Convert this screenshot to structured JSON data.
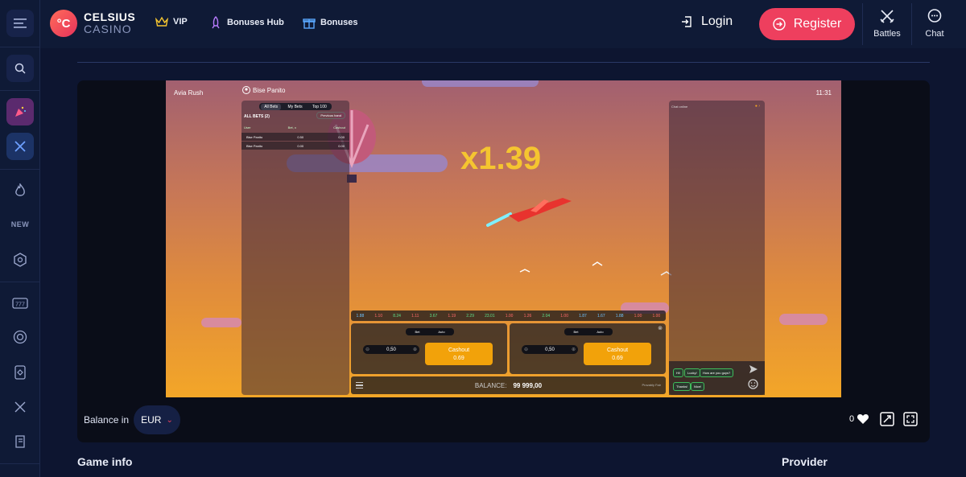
{
  "header": {
    "logo_top": "CELSIUS",
    "logo_bottom": "CASINO",
    "logo_mark": "°C",
    "nav": [
      {
        "label": "VIP",
        "icon": "crown-icon"
      },
      {
        "label": "Bonuses Hub",
        "icon": "rocket-icon"
      },
      {
        "label": "Bonuses",
        "icon": "gift-icon"
      }
    ],
    "login_label": "Login",
    "register_label": "Register",
    "battles_label": "Battles",
    "chat_label": "Chat"
  },
  "sidebar": {
    "new_label": "NEW"
  },
  "game": {
    "title": "Avia Rush",
    "user": "Bise Panito",
    "time": "11:31",
    "multiplier": "x1.39",
    "tabs": [
      "All Bets",
      "My Bets",
      "Top 100"
    ],
    "all_bets_label": "ALL BETS (2)",
    "previous_hand": "Previous hand",
    "table_headers": [
      "User",
      "Bet, x",
      "Cashout"
    ],
    "rows": [
      {
        "user": "Bise Panito",
        "bet": "0.50",
        "cashout": "0.00"
      },
      {
        "user": "Bise Panito",
        "bet": "0.00",
        "cashout": "0.00"
      }
    ],
    "history": [
      "1.88",
      "1.10",
      "8.24",
      "1.11",
      "3.67",
      "1.19",
      "2.29",
      "23.01",
      "1.00",
      "1.26",
      "2.04",
      "1.00",
      "1.87",
      "1.67",
      "1.88",
      "1.00",
      "1.00"
    ],
    "bet_tabs": [
      "Bet",
      "Auto"
    ],
    "bet_amount": "0,50",
    "cashout_label": "Cashout",
    "cashout_value": "0.69",
    "balance_label": "BALANCE:",
    "balance_value": "99 999,00",
    "provably_fair": "Provably Fair",
    "chat_title": "Chat online",
    "chat_msgs": [
      "Hi!",
      "Lucky!",
      "How are you guys?",
      "Thanks!",
      "Nice!"
    ]
  },
  "below": {
    "balance_in": "Balance in",
    "currency": "EUR",
    "likes": "0"
  },
  "sections": {
    "game_info": "Game info",
    "provider": "Provider"
  },
  "colors": {
    "accent": "#ee3f5e",
    "background": "#0d1530",
    "multiplier": "#f5c530",
    "cashout": "#f2a20a"
  }
}
